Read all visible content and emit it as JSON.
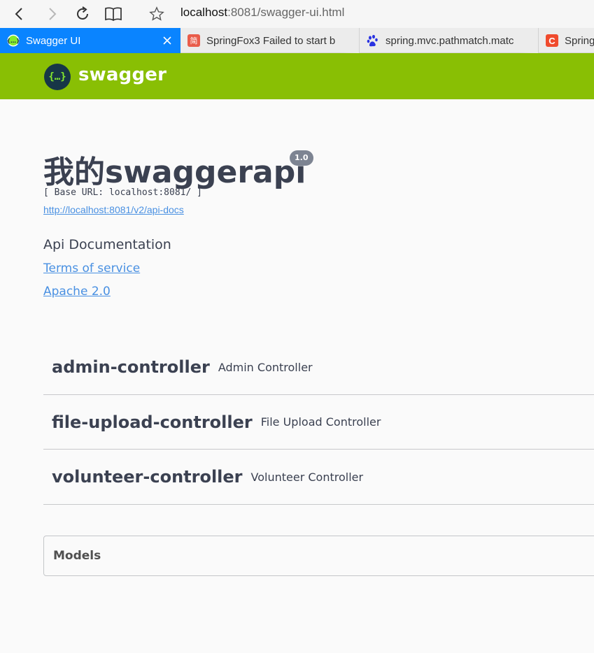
{
  "browser": {
    "url_host": "localhost",
    "url_rest": ":8081/swagger-ui.html",
    "tabs": [
      {
        "label": "Swagger UI",
        "favicon": "swagger-favicon",
        "active": true
      },
      {
        "label": "SpringFox3 Failed to start b",
        "favicon": "jianshu-favicon",
        "favicon_text": "简"
      },
      {
        "label": "spring.mvc.pathmatch.matc",
        "favicon": "baidu-favicon"
      },
      {
        "label": "Spring",
        "favicon": "csdn-favicon",
        "favicon_text": "C"
      }
    ]
  },
  "header": {
    "brand": "swagger"
  },
  "info": {
    "title": "我的swaggerapi",
    "version": "1.0",
    "base_url": "[ Base URL: localhost:8081/ ]",
    "spec_link": "http://localhost:8081/v2/api-docs",
    "description": "Api Documentation",
    "terms": "Terms of service",
    "license": "Apache 2.0"
  },
  "controllers": [
    {
      "name": "admin-controller",
      "description": "Admin Controller"
    },
    {
      "name": "file-upload-controller",
      "description": "File Upload Controller"
    },
    {
      "name": "volunteer-controller",
      "description": "Volunteer Controller"
    }
  ],
  "models": {
    "label": "Models"
  },
  "colors": {
    "header_bg": "#89bf04",
    "link": "#4990e2",
    "text": "#3b4151",
    "active_tab": "#0a84ff"
  }
}
